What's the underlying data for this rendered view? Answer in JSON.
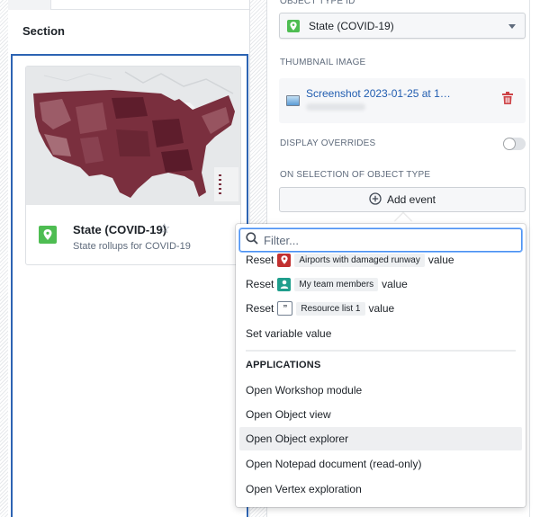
{
  "left_panel": {
    "section_title": "Section",
    "card": {
      "title": "State (COVID-19)",
      "subtitle": "State rollups for COVID-19",
      "thumbnail_alt": "US county map choropleth",
      "icon": "map-marker-icon",
      "favorite_icon": "star-outline-icon"
    }
  },
  "config_panel": {
    "object_type_label": "OBJECT TYPE ID",
    "object_type_value": "State (COVID-19)",
    "thumbnail_label": "THUMBNAIL IMAGE",
    "thumbnail_filename": "Screenshot 2023-01-25 at 1…",
    "display_overrides_label": "DISPLAY OVERRIDES",
    "display_overrides_enabled": false,
    "on_selection_label": "ON SELECTION OF OBJECT TYPE",
    "add_event_label": "Add event"
  },
  "event_menu": {
    "filter_placeholder": "Filter...",
    "reset_items": [
      {
        "prefix": "Reset",
        "chip": "Airports with damaged runway",
        "suffix": "value",
        "icon": "map-marker-icon",
        "icon_color": "#c23030"
      },
      {
        "prefix": "Reset",
        "chip": "My team members",
        "suffix": "value",
        "icon": "person-icon",
        "icon_color": "#1f9e8c"
      },
      {
        "prefix": "Reset",
        "chip": "Resource list 1",
        "suffix": "value",
        "icon": "quote-icon",
        "icon_color": "#738091"
      }
    ],
    "set_variable_label": "Set variable value",
    "applications_heading": "APPLICATIONS",
    "applications": [
      {
        "label": "Open Workshop module",
        "highlighted": false
      },
      {
        "label": "Open Object view",
        "highlighted": false
      },
      {
        "label": "Open Object explorer",
        "highlighted": true
      },
      {
        "label": "Open Notepad document (read-only)",
        "highlighted": false
      },
      {
        "label": "Open Vertex exploration",
        "highlighted": false
      }
    ]
  },
  "colors": {
    "accent": "#2d64b3",
    "link": "#215db0",
    "object_icon": "#4ebd52",
    "danger": "#cd4246",
    "map_fill": "#7a2f3e"
  }
}
